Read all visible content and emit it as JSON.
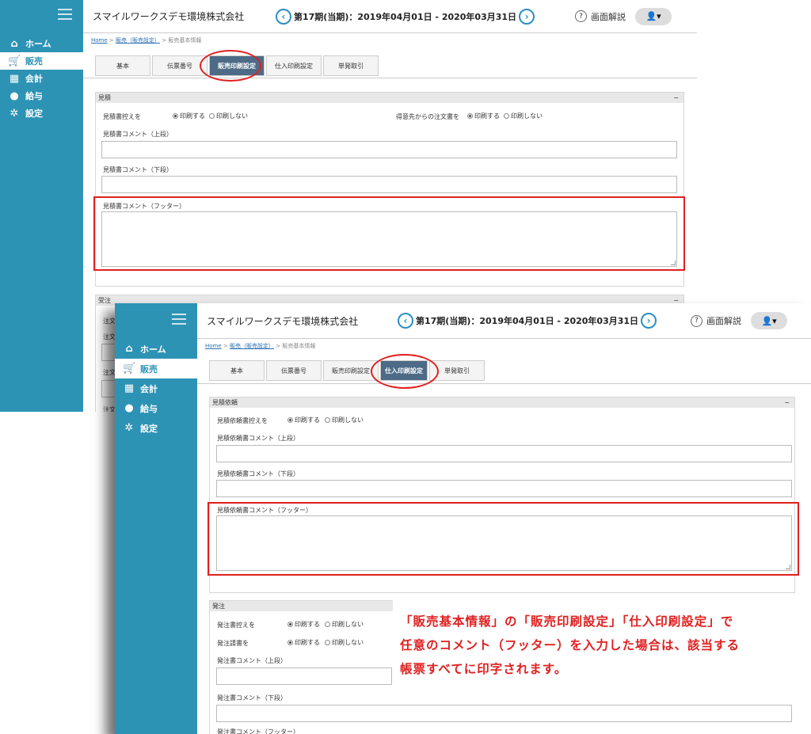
{
  "app": {
    "company": "スマイルワークスデモ環境株式会社",
    "period": "第17期(当期)：2019年04月01日 - 2020年03月31日",
    "help_label": "画面解説",
    "prev_icon": "chevron-left-icon",
    "next_icon": "chevron-right-icon"
  },
  "sidebar": {
    "items": [
      {
        "label": "ホーム",
        "icon": "home-icon"
      },
      {
        "label": "販売",
        "icon": "cart-icon"
      },
      {
        "label": "会計",
        "icon": "calculator-icon"
      },
      {
        "label": "給与",
        "icon": "money-bag-icon"
      },
      {
        "label": "設定",
        "icon": "gear-icon"
      }
    ]
  },
  "breadcrumb": {
    "home": "Home",
    "parent": "販売（販売設定）",
    "current": "販売基本情報"
  },
  "tabs": [
    "基本",
    "伝票番号",
    "販売印刷設定",
    "仕入印刷設定",
    "単発取引"
  ],
  "screen1": {
    "selected_tab": "販売印刷設定",
    "section": "見積",
    "collapse": "−",
    "row1_label": "見積書控えを",
    "row1_right_label": "得意先からの注文書を",
    "opt_print": "印刷する",
    "opt_noprint": "印刷しない",
    "comment_top": "見積書コメント（上段）",
    "comment_bottom": "見積書コメント（下段）",
    "comment_footer": "見積書コメント（フッター）",
    "next_section": "受注",
    "hidden_labels": [
      "注文",
      "注文",
      "注文",
      "注文"
    ]
  },
  "screen2": {
    "selected_tab": "仕入印刷設定",
    "section": "見積依頼",
    "collapse": "−",
    "row1_label": "見積依頼書控えを",
    "opt_print": "印刷する",
    "opt_noprint": "印刷しない",
    "comment_top": "見積依頼書コメント（上段）",
    "comment_bottom": "見積依頼書コメント（下段）",
    "comment_footer": "見積依頼書コメント（フッター）",
    "section2": "発注",
    "order_copy_label": "発注書控えを",
    "order_request_label": "発注請書を",
    "order_comment_top": "発注書コメント（上段）",
    "order_comment_bottom": "発注書コメント（下段）",
    "order_comment_footer": "発注書コメント（フッター）"
  },
  "caption": {
    "line1": "「販売基本情報」の「販売印刷設定」「仕入印刷設定」で",
    "line2": "任意のコメント（フッター）を入力した場合は、該当する",
    "line3": "帳票すべてに印字されます。"
  },
  "colors": {
    "sidebar": "#2d93b5",
    "accent": "#2b8fbf",
    "highlight": "#e02020",
    "selected_tab": "#4d6b86"
  }
}
